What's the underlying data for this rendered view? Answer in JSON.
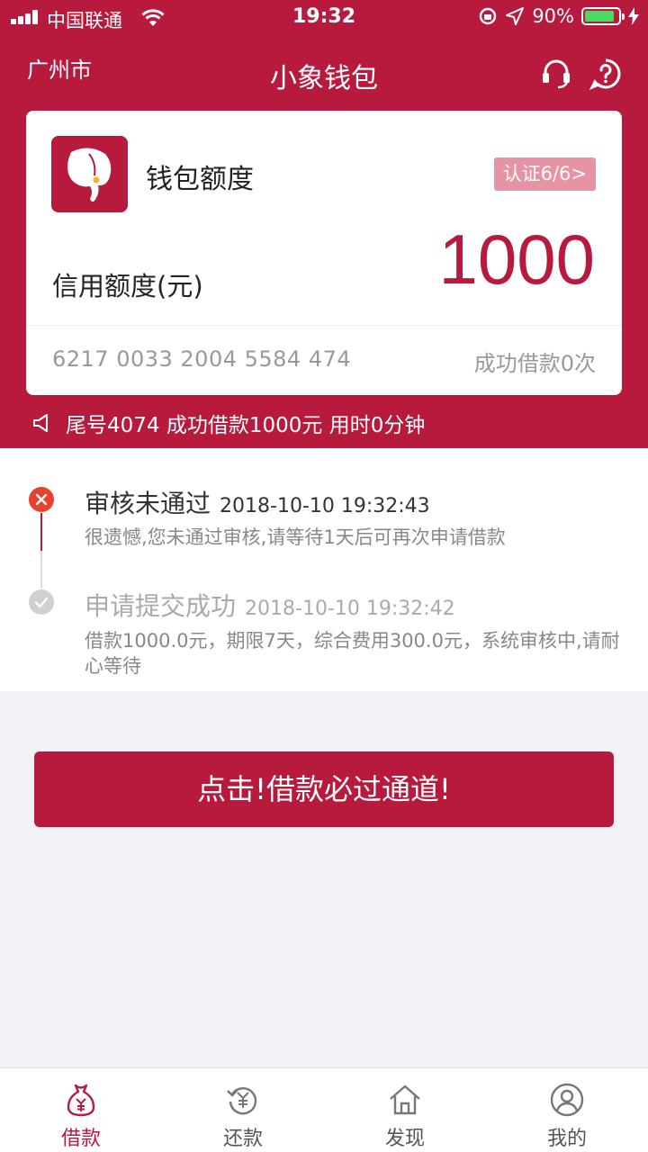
{
  "status_bar": {
    "carrier": "中国联通",
    "time": "19:32",
    "battery": "90%",
    "battery_level": 0.9
  },
  "nav": {
    "city": "广州市",
    "title": "小象钱包",
    "icons": [
      "headset-icon",
      "help-icon"
    ]
  },
  "wallet_card": {
    "title": "钱包额度",
    "cert_badge": "认证6/6>",
    "amount": "1000",
    "amount_label": "信用额度(元)",
    "card_number": "6217 0033 2004 5584 474",
    "loan_count": "成功借款0次"
  },
  "notice": {
    "text": "尾号4074 成功借款1000元 用时0分钟"
  },
  "timeline": [
    {
      "status": "审核未通过",
      "time": "2018-10-10 19:32:43",
      "desc": "很遗憾,您未通过审核,请等待1天后可再次申请借款"
    },
    {
      "status": "申请提交成功",
      "time": "2018-10-10 19:32:42",
      "desc": "借款1000.0元，期限7天，综合费用300.0元，系统审核中,请耐心等待"
    }
  ],
  "cta": {
    "label": "点击!借款必过通道!"
  },
  "tabbar": [
    {
      "label": "借款",
      "icon": "money-bag-icon",
      "active": true
    },
    {
      "label": "还款",
      "icon": "repay-icon",
      "active": false
    },
    {
      "label": "发现",
      "icon": "home-icon",
      "active": false
    },
    {
      "label": "我的",
      "icon": "user-icon",
      "active": false
    }
  ],
  "colors": {
    "brand": "#b81a3d",
    "badge": "#e693a6",
    "error": "#e8412c",
    "success_gray": "#cccccc"
  }
}
